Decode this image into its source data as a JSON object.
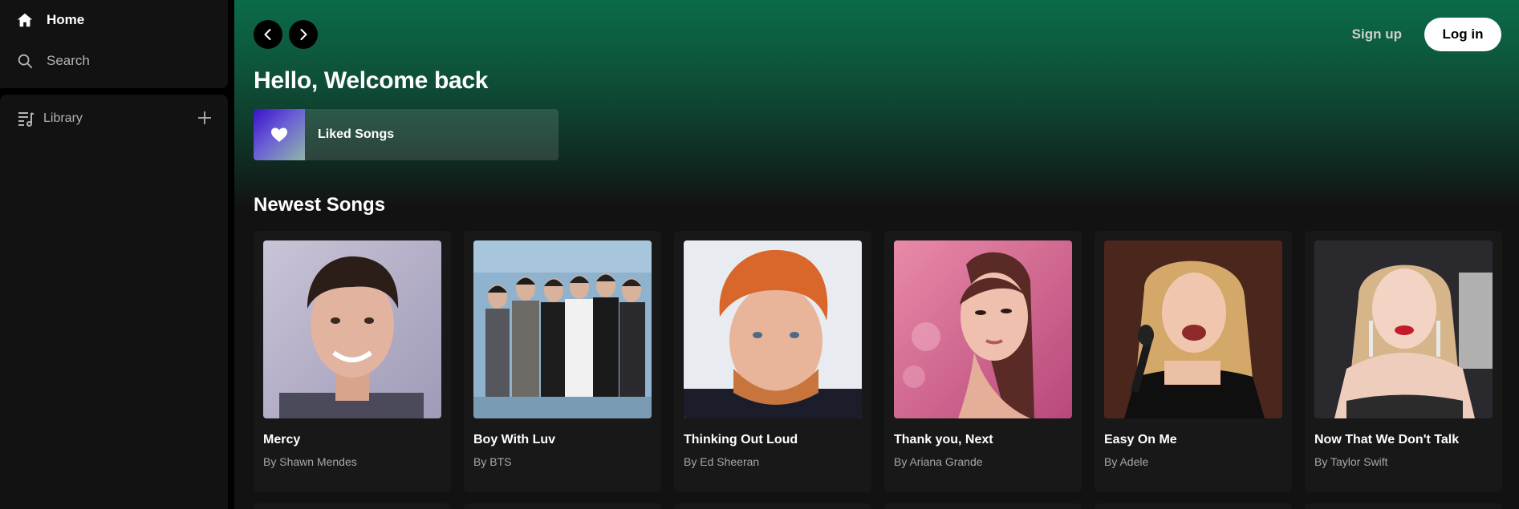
{
  "sidebar": {
    "home_label": "Home",
    "search_label": "Search",
    "library_label": "Library"
  },
  "header": {
    "signup_label": "Sign up",
    "login_label": "Log in"
  },
  "main": {
    "greeting": "Hello, Welcome back",
    "liked_songs_label": "Liked Songs",
    "section_title": "Newest Songs",
    "songs": [
      {
        "title": "Mercy",
        "artist": "By Shawn Mendes"
      },
      {
        "title": "Boy With Luv",
        "artist": "By BTS"
      },
      {
        "title": "Thinking Out Loud",
        "artist": "By Ed Sheeran"
      },
      {
        "title": "Thank you, Next",
        "artist": "By Ariana Grande"
      },
      {
        "title": "Easy On Me",
        "artist": "By Adele"
      },
      {
        "title": "Now That We Don't Talk",
        "artist": "By Taylor Swift"
      }
    ]
  },
  "colors": {
    "accent_green": "#0b6b48",
    "background": "#121212",
    "card": "#181818",
    "liked_gradient_start": "#3a11c9"
  }
}
